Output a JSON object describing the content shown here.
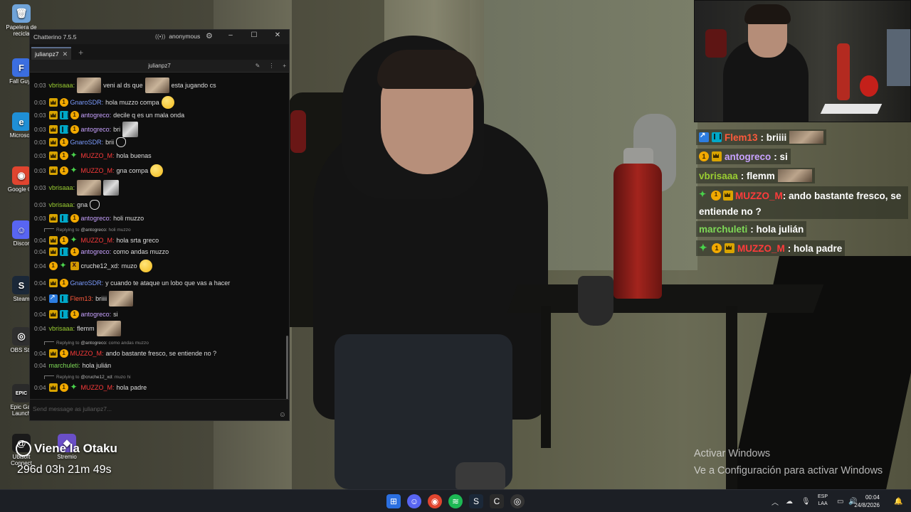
{
  "desktop": {
    "icons": [
      {
        "label": "Papelera de recicla",
        "glyph": "🗑",
        "color": "#6fa3d8"
      },
      {
        "label": "Fall Guys",
        "glyph": "F",
        "color": "#3b6ee0"
      },
      {
        "label": "Microsoft",
        "glyph": "e",
        "color": "#1f8fd6"
      },
      {
        "label": "Google Ch",
        "glyph": "◉",
        "color": "#e0452f"
      },
      {
        "label": "Discor",
        "glyph": "☺",
        "color": "#5865f2"
      },
      {
        "label": "Steam",
        "glyph": "S",
        "color": "#1b2838"
      },
      {
        "label": "OBS Stu",
        "glyph": "◎",
        "color": "#2f2f2f"
      },
      {
        "label": "Epic Gar Launch",
        "glyph": "EPIC",
        "color": "#2a2a2a"
      },
      {
        "label": "Ubisoft Connect",
        "glyph": "@",
        "color": "#1a1a1a"
      },
      {
        "label": "Stremio",
        "glyph": "◆",
        "color": "#6a4fc8"
      }
    ]
  },
  "chatterino": {
    "app_title": "Chatterino 7.5.5",
    "account": "anonymous",
    "tab_label": "julianpz7",
    "channel": "julianpz7",
    "input_placeholder": "Send message as julianpz7...",
    "messages": [
      {
        "time": "0:03",
        "badges": [],
        "user": "vbrisaaa:",
        "color": "#9acd32",
        "parts": [
          "emote",
          "veni al ds que",
          "emote",
          "esta jugando cs"
        ]
      },
      {
        "time": "0:03",
        "badges": [
          "crown",
          "sub"
        ],
        "user": "GnaroSDR:",
        "color": "#7b9cff",
        "parts": [
          "hola muzzo compa",
          "smiley"
        ]
      },
      {
        "time": "0:03",
        "badges": [
          "crown",
          "game",
          "sub"
        ],
        "user": "antogreco:",
        "color": "#c8a2ff",
        "parts": [
          "decile q es un mala onda"
        ]
      },
      {
        "time": "0:03",
        "badges": [
          "crown",
          "game",
          "sub"
        ],
        "user": "antogreco:",
        "color": "#c8a2ff",
        "parts": [
          "bri",
          "emote-small"
        ]
      },
      {
        "time": "0:03",
        "badges": [
          "crown",
          "sub"
        ],
        "user": "GnaroSDR:",
        "color": "#7b9cff",
        "parts": [
          "brii",
          "cat"
        ]
      },
      {
        "time": "0:03",
        "badges": [
          "crown",
          "sub",
          "green"
        ],
        "user": "MUZZO_M:",
        "color": "#ff3b3b",
        "parts": [
          "hola buenas"
        ]
      },
      {
        "time": "0:03",
        "badges": [
          "crown",
          "sub",
          "green"
        ],
        "user": "MUZZO_M:",
        "color": "#ff3b3b",
        "parts": [
          "gna compa",
          "smiley"
        ]
      },
      {
        "time": "0:03",
        "badges": [],
        "user": "vbrisaaa:",
        "color": "#9acd32",
        "parts": [
          "emote",
          "emote-small"
        ]
      },
      {
        "time": "0:03",
        "badges": [],
        "user": "vbrisaaa:",
        "color": "#9acd32",
        "parts": [
          "gna",
          "cat"
        ]
      },
      {
        "time": "0:03",
        "badges": [
          "crown",
          "game",
          "sub"
        ],
        "user": "antogreco:",
        "color": "#c8a2ff",
        "parts": [
          "holi muzzo"
        ]
      },
      {
        "time": "0:04",
        "badges": [
          "crown",
          "sub",
          "green"
        ],
        "user": "MUZZO_M:",
        "color": "#ff3b3b",
        "parts": [
          "hola srta greco"
        ]
      },
      {
        "time": "0:04",
        "badges": [
          "crown",
          "game",
          "sub"
        ],
        "user": "antogreco:",
        "color": "#c8a2ff",
        "parts": [
          "como andas muzzo"
        ]
      },
      {
        "time": "0:04",
        "badges": [
          "sub",
          "green",
          "xd"
        ],
        "user": "cruche12_xd:",
        "color": "#e0e0e0",
        "parts": [
          "muzo",
          "smiley"
        ]
      },
      {
        "time": "0:04",
        "badges": [
          "crown",
          "sub"
        ],
        "user": "GnaroSDR:",
        "color": "#7b9cff",
        "parts": [
          "y cuando te ataque un lobo que vas a hacer"
        ]
      },
      {
        "time": "0:04",
        "badges": [
          "arrow",
          "game"
        ],
        "user": "Flem13:",
        "color": "#ff5a3c",
        "parts": [
          "briiii",
          "emote"
        ]
      },
      {
        "time": "0:04",
        "badges": [
          "crown",
          "game",
          "sub"
        ],
        "user": "antogreco:",
        "color": "#c8a2ff",
        "parts": [
          "si"
        ]
      },
      {
        "time": "0:04",
        "badges": [],
        "user": "vbrisaaa:",
        "color": "#9acd32",
        "parts": [
          "flemm",
          "emote"
        ]
      },
      {
        "time": "0:04",
        "badges": [
          "crown",
          "sub"
        ],
        "user": "MUZZO_M:",
        "color": "#ff3b3b",
        "parts": [
          "ando bastante fresco, se entiende no ?"
        ]
      },
      {
        "time": "0:04",
        "badges": [],
        "user": "marchuleti:",
        "color": "#7ed957",
        "parts": [
          "hola julián"
        ]
      },
      {
        "time": "0:04",
        "badges": [
          "crown",
          "sub",
          "green"
        ],
        "user": "MUZZO_M:",
        "color": "#ff3b3b",
        "parts": [
          "hola padre"
        ]
      }
    ],
    "replies": [
      {
        "prefix": "Replying to",
        "who": "@antogreco:",
        "text": "holi muzzo"
      },
      {
        "prefix": "Replying to",
        "who": "@antogreco:",
        "text": "como andas muzzo"
      },
      {
        "prefix": "Replying to",
        "who": "@cruche12_xd:",
        "text": "muzo hi"
      }
    ]
  },
  "overlay": {
    "chat": [
      {
        "badges": [
          "arrow",
          "game"
        ],
        "user": "Flem13",
        "color": "#ff5a3c",
        "text": ": briiii",
        "emote": true
      },
      {
        "badges": [
          "sub",
          "crown"
        ],
        "user": "antogreco",
        "color": "#c8a2ff",
        "text": ": si",
        "emote": false
      },
      {
        "badges": [],
        "user": "vbrisaaa",
        "color": "#9acd32",
        "text": ": flemm",
        "emote": true
      },
      {
        "badges": [
          "green",
          "sub",
          "crown"
        ],
        "user": "MUZZO_M",
        "color": "#ff3b3b",
        "text": ": ando bastante fresco, se entiende no ?",
        "emote": false
      },
      {
        "badges": [],
        "user": "marchuleti",
        "color": "#7ed957",
        "text": ": hola julián",
        "emote": false
      },
      {
        "badges": [
          "green",
          "sub",
          "crown"
        ],
        "user": "MUZZO_M",
        "color": "#ff3b3b",
        "text": ": hola padre",
        "emote": false
      }
    ],
    "banner": "Viene la Otaku",
    "timer": "296d 03h 21m 49s",
    "activate_title": "Activar Windows",
    "activate_sub": "Ve a Configuración para activar Windows"
  },
  "taskbar": {
    "lang_top": "ESP",
    "lang_bottom": "LAA",
    "time": "00:04",
    "date": "24/8/2026"
  }
}
